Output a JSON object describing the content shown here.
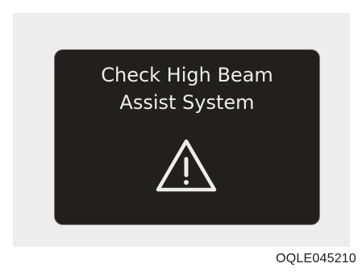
{
  "display": {
    "line1": "Check High Beam",
    "line2": "Assist System",
    "icon": "warning-triangle-icon"
  },
  "figure_code": "OQLE045210",
  "colors": {
    "screen": "#221f1f",
    "text": "#ededed",
    "background": "#ededed"
  }
}
